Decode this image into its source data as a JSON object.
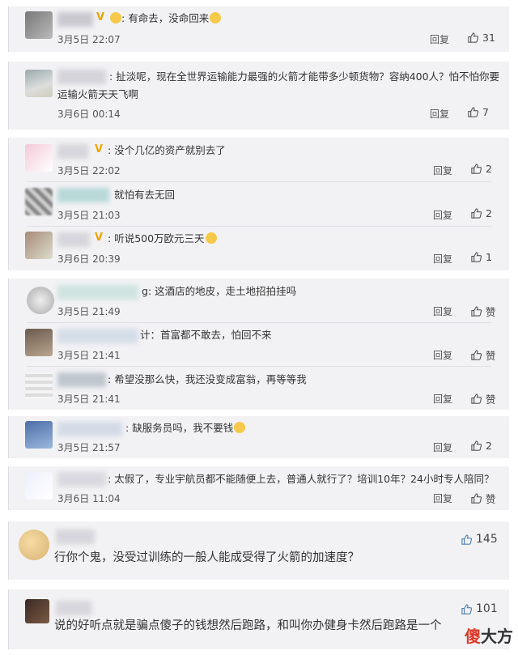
{
  "reply_label": "回复",
  "comments": [
    {
      "text": "有命去，没命回来",
      "time": "3月5日 22:07",
      "likes": "31",
      "emoji": true
    },
    {
      "name": "丶",
      "text_line1": "扯淡呢，现在全世界运输能力最强的火箭才能带多少顿货物？容纳400人？怕不怕你要",
      "text_line2": "运输火箭天天飞啊",
      "time": "3月6日 00:14",
      "likes": "7"
    },
    {
      "name": "忱",
      "text": "没个几亿的资产就别去了",
      "time": "3月5日 22:02",
      "likes": "2"
    },
    {
      "name": "过",
      "text": "就怕有去无回",
      "time": "3月5日 21:03",
      "likes": "2"
    },
    {
      "name": "仨",
      "text": "听说500万欧元三天",
      "time": "3月6日 20:39",
      "likes": "1",
      "emoji": true
    },
    {
      "name": "E",
      "text": "g: 这酒店的地皮，走土地招拍挂吗",
      "time": "3月5日 21:49",
      "likes": "赞"
    },
    {
      "name": "李",
      "text": "计：首富都不敢去，怕回不来",
      "time": "3月5日 21:41",
      "likes": "赞"
    },
    {
      "text": "希望没那么快，我还没变成富翁，再等等我",
      "time": "3月5日 21:41",
      "likes": "赞"
    },
    {
      "name": "别",
      "text": "缺服务员吗，我不要钱",
      "time": "3月5日 21:57",
      "likes": "2",
      "emoji": true
    },
    {
      "name": "B",
      "text": "太假了，专业宇航员都不能随便上去，普通人就行了？培训10年？24小时专人陪同？",
      "time": "3月6日 11:04",
      "likes": "赞"
    },
    {
      "name": "二",
      "text": "行你个鬼，没受过训练的一般人能成受得了火箭的加速度？",
      "likes": "145"
    },
    {
      "name": "s",
      "text": "说的好听点就是骗点傻子的钱想然后跑路，和叫你办健身卡然后跑路是一个",
      "likes": "101"
    }
  ],
  "watermark": {
    "red": "傻",
    "black": "大方"
  },
  "colors": {
    "card": "#f2f2f4",
    "vip": "#f0a400",
    "watermark_red": "#e03a2a"
  }
}
